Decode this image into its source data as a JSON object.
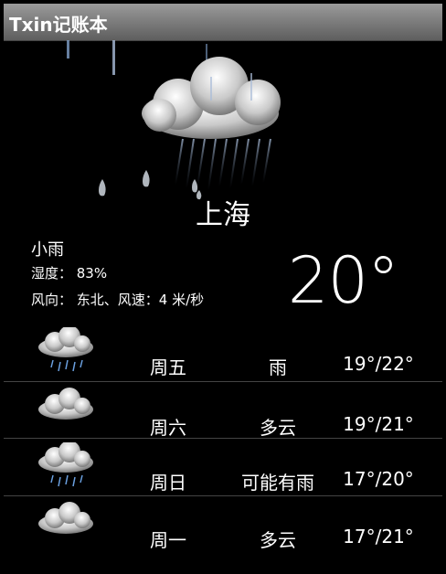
{
  "app": {
    "title": "Txin记账本"
  },
  "current": {
    "city": "上海",
    "condition": "小雨",
    "humidity_label": "湿度： 83%",
    "wind_label": "风向： 东北、风速：4 米/秒",
    "temperature": "20°",
    "icon": "rain-cloud-icon"
  },
  "forecast": [
    {
      "day": "周五",
      "desc": "雨",
      "range": "19°/22°",
      "icon": "rain-cloud-icon"
    },
    {
      "day": "周六",
      "desc": "多云",
      "range": "19°/21°",
      "icon": "cloud-icon"
    },
    {
      "day": "周日",
      "desc": "可能有雨",
      "range": "17°/20°",
      "icon": "rain-cloud-icon"
    },
    {
      "day": "周一",
      "desc": "多云",
      "range": "17°/21°",
      "icon": "cloud-icon"
    }
  ]
}
